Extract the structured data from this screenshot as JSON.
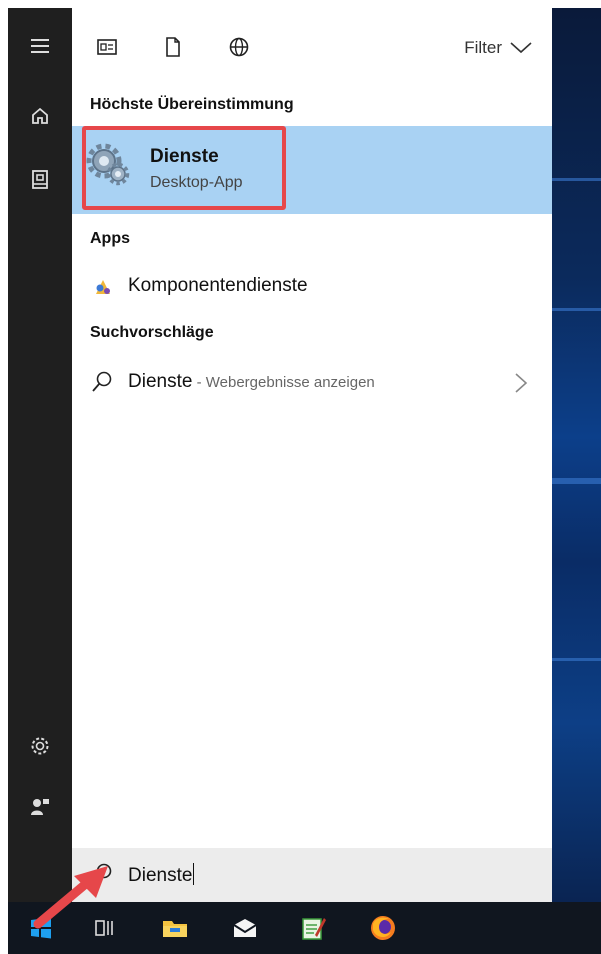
{
  "topbar": {
    "filter_label": "Filter",
    "icons": [
      "apps-icon",
      "document-icon",
      "web-icon"
    ]
  },
  "sections": {
    "best_match": "Höchste Übereinstimmung",
    "apps": "Apps",
    "suggestions": "Suchvorschläge"
  },
  "best_match": {
    "title": "Dienste",
    "subtitle": "Desktop-App",
    "icon": "services-gear-icon"
  },
  "apps": [
    {
      "label": "Komponentendienste",
      "icon": "component-services-icon"
    }
  ],
  "suggestions": [
    {
      "term": "Dienste",
      "hint": " - Webergebnisse anzeigen",
      "icon": "search-icon"
    }
  ],
  "search": {
    "value": "Dienste",
    "icon": "search-icon"
  },
  "rail": [
    "hamburger-menu-icon",
    "home-icon",
    "notebook-icon",
    "settings-icon",
    "feedback-icon"
  ],
  "taskbar": [
    "windows-start-icon",
    "task-view-icon",
    "file-explorer-icon",
    "mail-icon",
    "notepad-icon",
    "firefox-icon"
  ],
  "colors": {
    "highlight": "#a9d2f3",
    "annotation_red": "#e6474a",
    "rail": "#1f1f1f",
    "taskbar": "#10161f"
  }
}
